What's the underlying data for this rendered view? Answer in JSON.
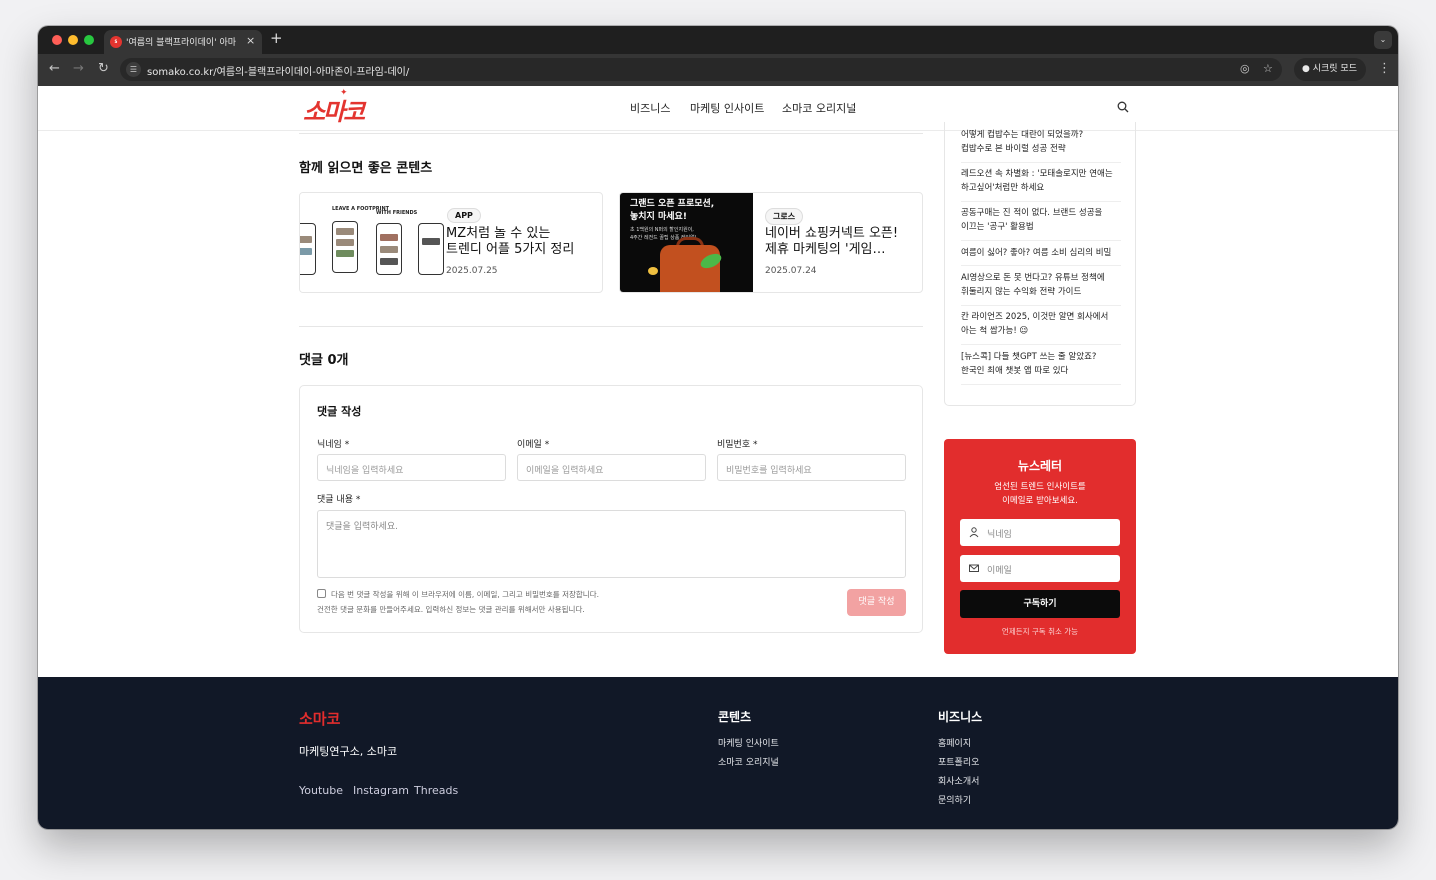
{
  "browser": {
    "tab_title": "'여름의 블랙프라이데이' 아마존이",
    "tab_close": "×",
    "new_tab": "+",
    "tab_menu": "⌄",
    "url": "somako.co.kr/여름의-블랙프라이데이-아마존이-프라임-데이/",
    "incognito_label": "시크릿 모드"
  },
  "site": {
    "logo": "소마코",
    "nav": [
      "비즈니스",
      "마케팅 인사이트",
      "소마코 오리지널"
    ]
  },
  "related": {
    "heading": "함께 읽으면 좋은 콘텐츠",
    "cards": [
      {
        "badge": "APP",
        "title_l1": "MZ처럼 놀 수 있는",
        "title_l2": "트렌디 어플 5가지 정리",
        "date": "2025.07.25",
        "thumb_text": [
          "LEAVE A FOOTPRINT",
          "WITH FRIENDS"
        ]
      },
      {
        "badge": "그로스",
        "title_l1": "네이버 쇼핑커넥트 오픈!",
        "title_l2": "제휴 마케팅의 '게임…",
        "date": "2025.07.24",
        "thumb_l1": "그랜드 오픈 프로모션,",
        "thumb_l2": "놓치지 마세요!",
        "thumb_s1": "초 1백원의 N퍼의 할인지원이,",
        "thumb_s2": "4주간 레전드 꿀팁 상품 레인업!"
      }
    ]
  },
  "comments": {
    "heading": "댓글 0개",
    "form_heading": "댓글 작성",
    "nickname_label": "닉네임 *",
    "nickname_placeholder": "닉네임을 입력하세요",
    "email_label": "이메일 *",
    "email_placeholder": "이메일을 입력하세요",
    "password_label": "비밀번호 *",
    "password_placeholder": "비밀번호를 입력하세요",
    "content_label": "댓글 내용 *",
    "content_placeholder": "댓글을 입력하세요.",
    "save_info": "다음 번 댓글 작성을 위해 이 브라우저에 이름, 이메일, 그리고 비밀번호를 저장합니다.",
    "notice": "건전한 댓글 문화를 만들어주세요. 입력하신 정보는 댓글 관리를 위해서만 사용됩니다.",
    "submit_label": "댓글 작성"
  },
  "sidebar": {
    "items": [
      [
        "어떻게 컵밥수는 대란이 되었을까?",
        "컵밥수로 본 바이럴 성공 전략"
      ],
      [
        "레드오션 속 차별화 : '모태솔로지만 연애는",
        "하고싶어'처럼만 하세요"
      ],
      [
        "공동구매는 진 적이 없다. 브랜드 성공을",
        "이끄는 '공구' 활용법"
      ],
      [
        "여름이 싫어? 좋아? 여름 소비 심리의 비밀"
      ],
      [
        "AI영상으로 돈 못 번다고? 유튜브 정책에",
        "휘둘리지 않는 수익화 전략 가이드"
      ],
      [
        "칸 라이언즈 2025, 이것만 알면 회사에서",
        "아는 척 쌉가능! 😉"
      ],
      [
        "[뉴스콕] 다들 챗GPT 쓰는 줄 알았죠?",
        "한국인 최애 챗봇 앱 따로 있다"
      ]
    ]
  },
  "newsletter": {
    "title": "뉴스레터",
    "desc_l1": "엄선된 트렌드 인사이트를",
    "desc_l2": "이메일로 받아보세요.",
    "name_placeholder": "닉네임",
    "email_placeholder": "이메일",
    "button": "구독하기",
    "footnote": "언제든지 구독 취소 가능"
  },
  "footer": {
    "brand": "소마코",
    "tagline": "마케팅연구소, 소마코",
    "social": [
      "Youtube",
      "Instagram",
      "Threads"
    ],
    "col1_title": "콘텐츠",
    "col1_links": [
      "마케팅 인사이트",
      "소마코 오리지널"
    ],
    "col2_title": "비즈니스",
    "col2_links": [
      "홈페이지",
      "포트폴리오",
      "회사소개서",
      "문의하기"
    ]
  }
}
